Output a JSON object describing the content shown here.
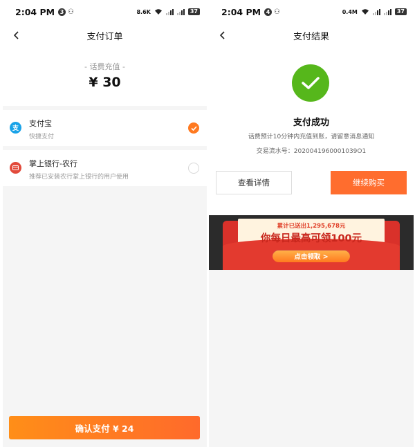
{
  "left_screen": {
    "status_bar": {
      "time": "2:04 PM",
      "notif_count": "3",
      "net_speed": "8.6K",
      "battery": "37"
    },
    "nav": {
      "title": "支付订单"
    },
    "amount": {
      "label": "- 话费充值 -",
      "value": "¥ 30"
    },
    "payment_methods": [
      {
        "name": "支付宝",
        "desc": "快捷支付",
        "icon": "alipay-icon",
        "icon_color": "#1aa3e8",
        "selected": true
      },
      {
        "name": "掌上银行-农行",
        "desc": "推荐已安装农行掌上银行的用户使用",
        "icon": "bank-card-icon",
        "icon_color": "#e24a3b",
        "selected": false
      }
    ],
    "confirm_button": "确认支付 ¥ 24"
  },
  "right_screen": {
    "status_bar": {
      "time": "2:04 PM",
      "notif_count": "4",
      "net_speed": "0.4M",
      "battery": "37"
    },
    "nav": {
      "title": "支付结果"
    },
    "result": {
      "title": "支付成功",
      "note": "话费预计10分钟内充值到账，请留意消息通知",
      "serial": "交易流水号：2020041960001039O1"
    },
    "buttons": {
      "detail": "查看详情",
      "continue": "继续购买"
    },
    "banner": {
      "line1": "累计已送出1,295,678元",
      "line2": "你每日最高可领100元",
      "cta": "点击领取 >"
    }
  },
  "colors": {
    "accent": "#ff6d2e",
    "success": "#56b71b",
    "alipay": "#1aa3e8",
    "bank": "#e24a3b"
  }
}
